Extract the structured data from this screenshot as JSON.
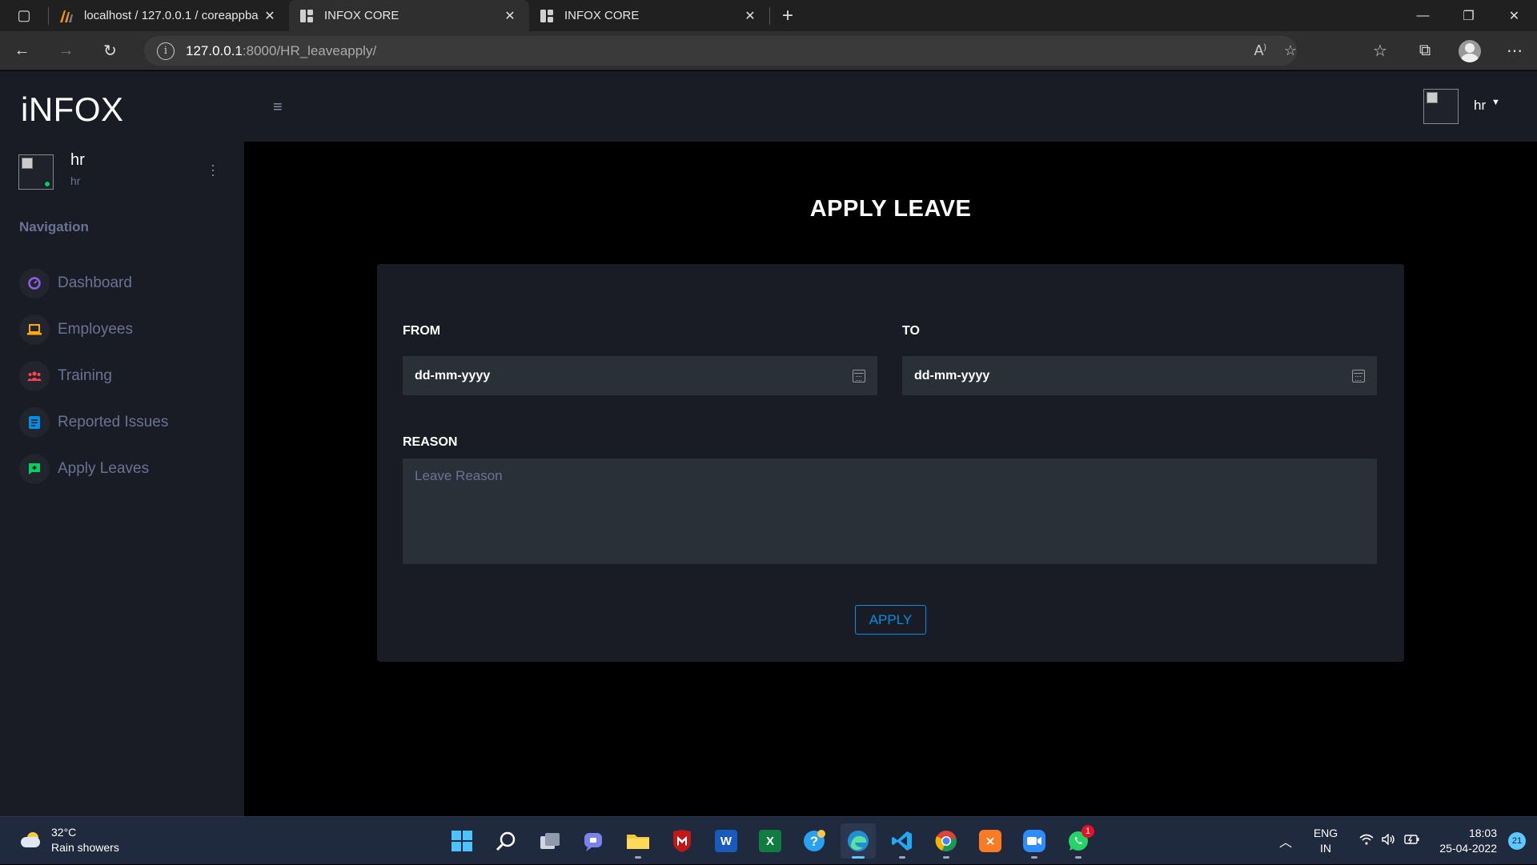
{
  "browser": {
    "tabs": [
      {
        "title": "localhost / 127.0.0.1 / coreappba",
        "icon": "phpmyadmin-icon",
        "active": false
      },
      {
        "title": "INFOX CORE",
        "icon": "page-icon",
        "active": true
      },
      {
        "title": "INFOX CORE",
        "icon": "page-icon",
        "active": false
      }
    ],
    "url_host": "127.0.0.1",
    "url_path": ":8000/HR_leaveapply/"
  },
  "sidebar": {
    "brand": "iNFOX",
    "user_name": "hr",
    "user_role": "hr",
    "nav_category": "Navigation",
    "items": [
      {
        "label": "Dashboard",
        "icon": "dashboard-icon",
        "color": "#8f5fe8"
      },
      {
        "label": "Employees",
        "icon": "laptop-icon",
        "color": "#ffab00"
      },
      {
        "label": "Training",
        "icon": "people-icon",
        "color": "#fc424a"
      },
      {
        "label": "Reported Issues",
        "icon": "document-icon",
        "color": "#0090e7"
      },
      {
        "label": "Apply Leaves",
        "icon": "chat-icon",
        "color": "#00d25b"
      }
    ]
  },
  "topnav": {
    "user": "hr"
  },
  "form": {
    "title": "APPLY LEAVE",
    "from_label": "FROM",
    "from_value": "dd-mm-yyyy",
    "to_label": "TO",
    "to_value": "dd-mm-yyyy",
    "reason_label": "REASON",
    "reason_placeholder": "Leave Reason",
    "submit_label": "APPLY"
  },
  "taskbar": {
    "temperature": "32°C",
    "weather": "Rain showers",
    "lang_1": "ENG",
    "lang_2": "IN",
    "time": "18:03",
    "date": "25-04-2022",
    "notifications": "21",
    "whatsapp_badge": "1"
  },
  "colors": {
    "accent": "#0090e7",
    "sidebar_bg": "#191c24",
    "input_bg": "#2a3038"
  }
}
